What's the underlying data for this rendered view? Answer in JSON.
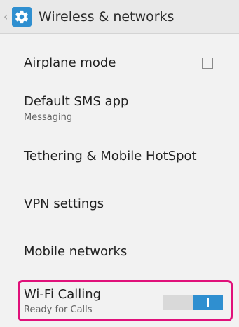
{
  "header": {
    "title": "Wireless & networks",
    "back_icon": "chevron-left-icon",
    "settings_icon": "gear-icon"
  },
  "settings": {
    "airplane_mode": {
      "title": "Airplane mode",
      "checked": false
    },
    "default_sms": {
      "title": "Default SMS app",
      "subtitle": "Messaging"
    },
    "tethering": {
      "title": "Tethering & Mobile HotSpot"
    },
    "vpn": {
      "title": "VPN settings"
    },
    "mobile_networks": {
      "title": "Mobile networks"
    },
    "wifi_calling": {
      "title": "Wi-Fi Calling",
      "subtitle": "Ready for Calls",
      "enabled": true
    }
  },
  "colors": {
    "accent": "#2f8fd0",
    "highlight": "#e0117a",
    "background": "#f2f2f2"
  }
}
